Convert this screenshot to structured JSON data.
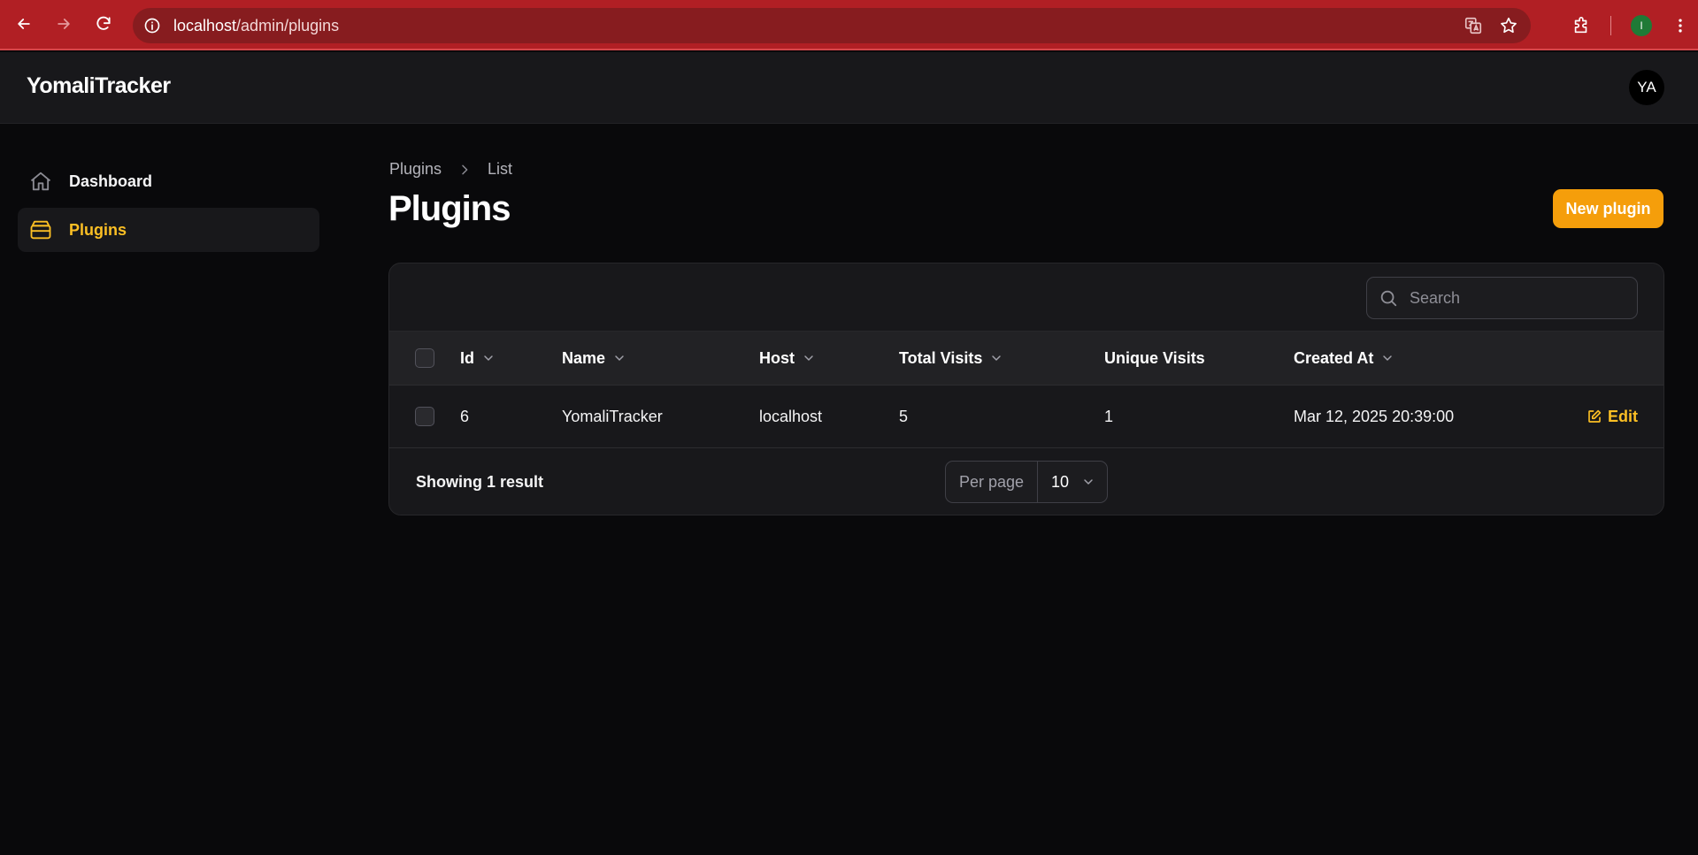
{
  "browser": {
    "url_host": "localhost",
    "url_path": "/admin/plugins",
    "profile_initial": "I"
  },
  "app": {
    "brand": "YomaliTracker",
    "avatar_initials": "YA"
  },
  "sidebar": {
    "items": [
      {
        "label": "Dashboard",
        "icon": "home-icon",
        "active": false
      },
      {
        "label": "Plugins",
        "icon": "archive-box-icon",
        "active": true
      }
    ]
  },
  "breadcrumb": {
    "parent": "Plugins",
    "current": "List"
  },
  "page": {
    "title": "Plugins",
    "new_button": "New plugin"
  },
  "table": {
    "search_placeholder": "Search",
    "columns": {
      "id": "Id",
      "name": "Name",
      "host": "Host",
      "total_visits": "Total Visits",
      "unique_visits": "Unique Visits",
      "created_at": "Created At"
    },
    "rows": [
      {
        "id": "6",
        "name": "YomaliTracker",
        "host": "localhost",
        "total_visits": "5",
        "unique_visits": "1",
        "created_at": "Mar 12, 2025 20:39:00",
        "action": "Edit"
      }
    ],
    "showing_text": "Showing 1 result",
    "per_page_label": "Per page",
    "per_page_value": "10"
  },
  "colors": {
    "accent": "#f59e0b",
    "accent_text": "#fbbf24",
    "browser_frame": "#b11f24",
    "background": "#09090b",
    "surface": "#18181b"
  }
}
